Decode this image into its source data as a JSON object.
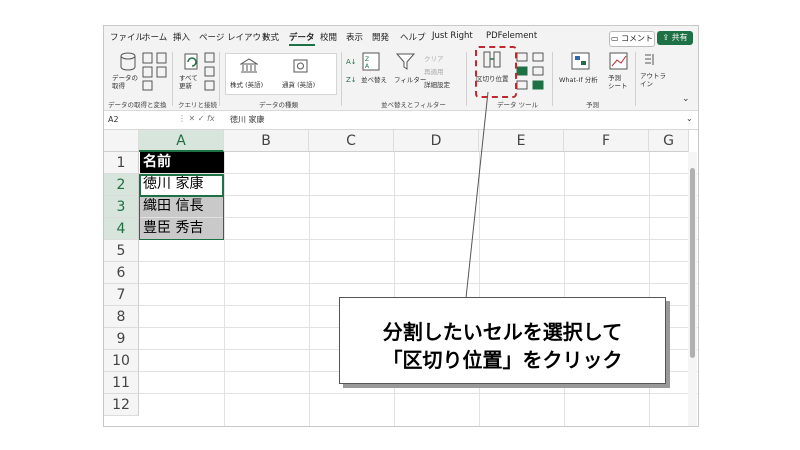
{
  "menu": {
    "items": [
      "ファイル",
      "ホーム",
      "挿入",
      "ページ レイアウト",
      "数式",
      "データ",
      "校閲",
      "表示",
      "開発",
      "ヘルプ",
      "Just Right",
      "PDFelement"
    ],
    "active": "データ",
    "comment_label": "コメント",
    "share_label": "共有"
  },
  "ribbon": {
    "get_data_label": "データの\n取得",
    "refresh_label": "すべて\n更新",
    "stocks_label": "株式 (英語)",
    "currency_label": "通貨 (英語)",
    "sort_label": "並べ替え",
    "filter_label": "フィルター",
    "clear_label": "クリア",
    "reapply_label": "再適用",
    "advanced_label": "詳細設定",
    "text_to_columns_label": "区切り位置",
    "whatif_label": "What-If 分析",
    "forecast_label": "予測\nシート",
    "outline_label": "アウトラ\nイン",
    "groups": {
      "get_transform": "データの取得と変換",
      "queries": "クエリと接続",
      "data_types": "データの種類",
      "sort_filter": "並べ替えとフィルター",
      "data_tools": "データ ツール",
      "forecast": "予測"
    },
    "accent_color": "#1e7145",
    "highlight_color": "#c0282d"
  },
  "formula_bar": {
    "name_box": "A2",
    "fx": "fx",
    "content": "徳川 家康"
  },
  "sheet": {
    "columns": [
      "A",
      "B",
      "C",
      "D",
      "E",
      "F",
      "G"
    ],
    "rows": [
      "1",
      "2",
      "3",
      "4",
      "5",
      "6",
      "7",
      "8",
      "9",
      "10",
      "11",
      "12"
    ],
    "cells": [
      "名前",
      "徳川 家康",
      "織田 信長",
      "豊臣 秀吉"
    ]
  },
  "callout": {
    "line1": "分割したいセルを選択して",
    "line2": "「区切り位置」をクリック"
  }
}
